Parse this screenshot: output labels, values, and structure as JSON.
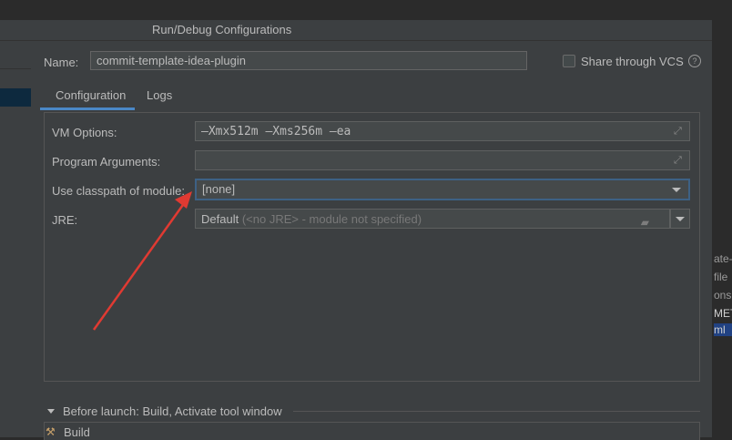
{
  "window": {
    "title": "Run/Debug Configurations"
  },
  "name": {
    "label": "Name:",
    "value": "commit-template-idea-plugin"
  },
  "vcs": {
    "label": "Share through VCS",
    "checked": false,
    "help_icon": "question-icon"
  },
  "tabs": [
    {
      "label": "Configuration",
      "active": true
    },
    {
      "label": "Logs",
      "active": false
    }
  ],
  "form": {
    "vm_options": {
      "label": "VM Options:",
      "value": "—Xmx512m —Xms256m —ea"
    },
    "program_arguments": {
      "label": "Program Arguments:",
      "value": ""
    },
    "classpath_module": {
      "label": "Use classpath of module:",
      "value": "[none]"
    },
    "jre": {
      "label": "JRE:",
      "value_main": "Default",
      "value_hint": "(<no JRE> - module not specified)"
    }
  },
  "before_launch": {
    "label": "Before launch: Build, Activate tool window",
    "items": [
      {
        "label": "Build",
        "icon": "hammer-icon"
      }
    ]
  },
  "background_fragments": [
    "ate-",
    "file",
    "ons.",
    "MET",
    "ml"
  ],
  "colors": {
    "accent": "#4a88c7",
    "annotation_arrow": "#e03a32",
    "focus_border": "#3d6185"
  }
}
